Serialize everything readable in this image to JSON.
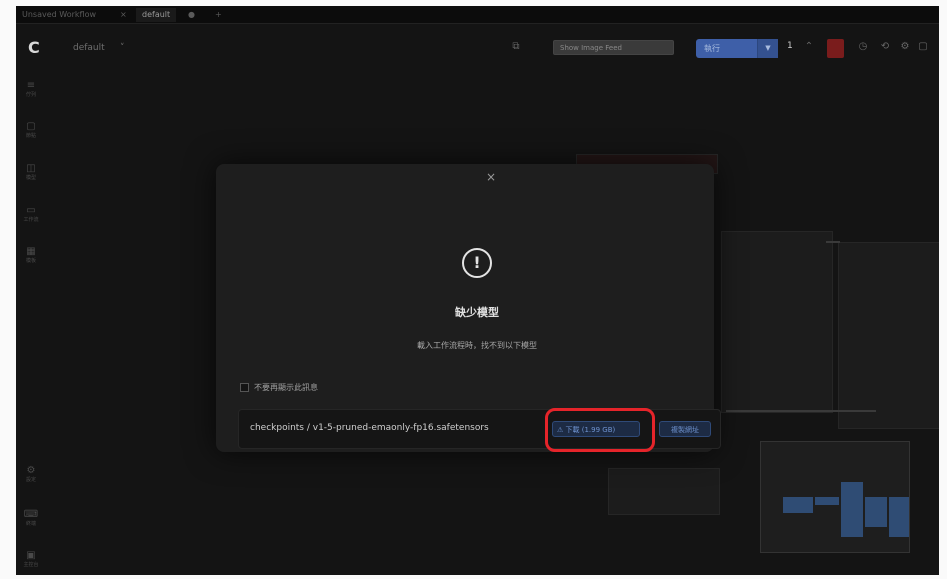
{
  "tabs": [
    {
      "label": "Unsaved Workflow"
    },
    {
      "label": "default"
    }
  ],
  "header": {
    "logo": "C",
    "workflow_name": "default",
    "show_image_feed": "Show Image Feed",
    "run_label": "執行",
    "queue_count": "1"
  },
  "sidebar": {
    "items": [
      {
        "icon": "≡",
        "label": "佇列"
      },
      {
        "icon": "▢",
        "label": "節點"
      },
      {
        "icon": "◫",
        "label": "模型"
      },
      {
        "icon": "▭",
        "label": "工作流"
      },
      {
        "icon": "▦",
        "label": "模板"
      },
      {
        "icon": "⚙",
        "label": "設定"
      },
      {
        "icon": "⌨",
        "label": "終端"
      },
      {
        "icon": "▣",
        "label": "主控台"
      }
    ]
  },
  "dialog": {
    "close": "×",
    "warning_icon": "!",
    "title": "缺少模型",
    "message": "載入工作流程時，找不到以下模型",
    "checkbox_label": "不要再顯示此訊息",
    "model_path": "checkpoints / v1-5-pruned-emaonly-fp16.safetensors",
    "download_label": "下載 (1.99 GB)",
    "copy_label": "複製網址"
  },
  "colors": {
    "accent": "#3e5fa8",
    "highlight": "#e5242a",
    "background": "#141414",
    "dialog": "#1e1e1e"
  }
}
